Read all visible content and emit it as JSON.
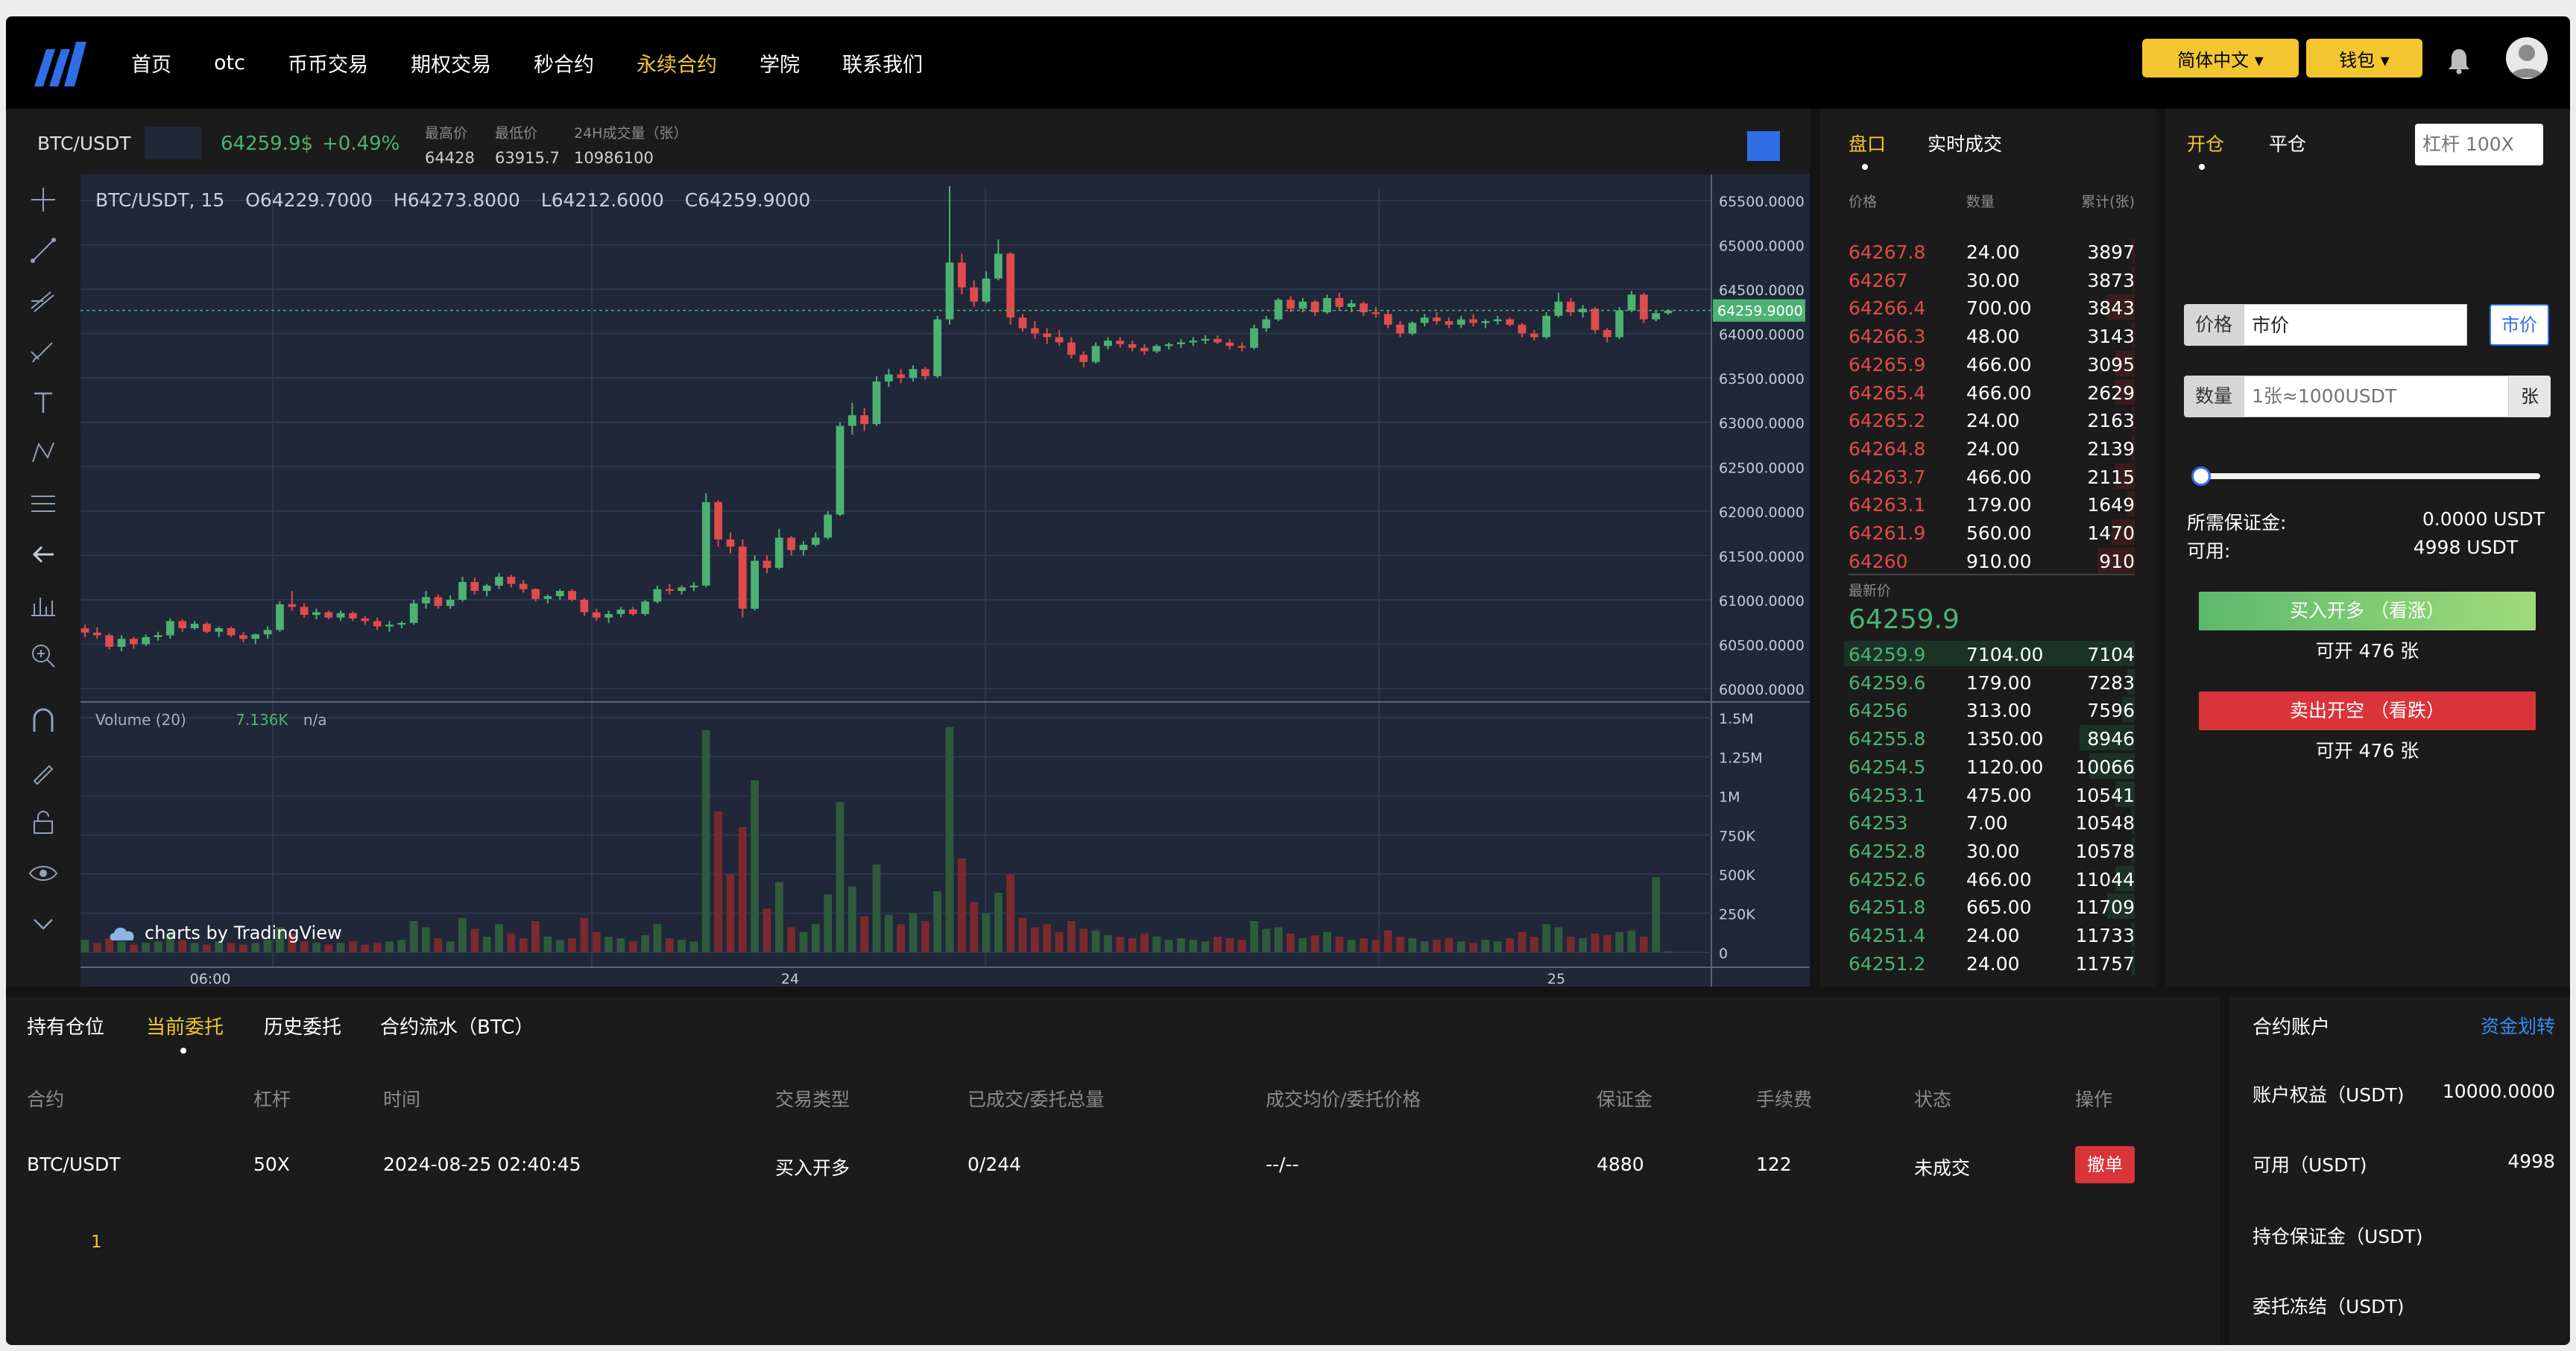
{
  "nav": {
    "items": [
      "首页",
      "otc",
      "币币交易",
      "期权交易",
      "秒合约",
      "永续合约",
      "学院",
      "联系我们"
    ],
    "active_index": 5,
    "lang_label": "简体中文 ▾",
    "wallet_label": "钱包 ▾"
  },
  "ticker": {
    "pair": "BTC/USDT",
    "last_price": "64259.9$",
    "change": "+0.49%",
    "high_label": "最高价",
    "high_value": "64428",
    "low_label": "最低价",
    "low_value": "63915.7",
    "vol_label": "24H成交量（张）",
    "vol_value": "10986100"
  },
  "chart": {
    "symbol": "BTC/USDT, 15",
    "open": "O64229.7000",
    "high": "H64273.8000",
    "low": "L64212.6000",
    "close": "C64259.9000",
    "volume_label": "Volume (20)",
    "volume_value": "7.136K",
    "volume_na": "n/a",
    "brand": "charts by TradingView",
    "current_price_label": "64259.9000",
    "price_ticks": [
      "65500.0000",
      "65000.0000",
      "64500.0000",
      "64000.0000",
      "63500.0000",
      "63000.0000",
      "62500.0000",
      "62000.0000",
      "61500.0000",
      "61000.0000",
      "60500.0000",
      "60000.0000"
    ],
    "volume_ticks": [
      "1.5M",
      "1.25M",
      "1M",
      "750K",
      "500K",
      "250K",
      "0"
    ],
    "time_ticks": [
      "06:00",
      "24",
      "25"
    ]
  },
  "chart_data": {
    "type": "candlestick",
    "title": "BTC/USDT, 15",
    "ylim": [
      60000,
      65500
    ],
    "volume_ylim": [
      0,
      1500000
    ],
    "colors": {
      "up": "#4cb272",
      "down": "#e04b4b",
      "background": "#1f2738"
    },
    "candles": [
      [
        60680,
        60720,
        60580,
        60630
      ],
      [
        60630,
        60690,
        60560,
        60600
      ],
      [
        60600,
        60620,
        60440,
        60470
      ],
      [
        60470,
        60600,
        60420,
        60560
      ],
      [
        60560,
        60580,
        60450,
        60500
      ],
      [
        60500,
        60610,
        60480,
        60580
      ],
      [
        60580,
        60640,
        60540,
        60600
      ],
      [
        60600,
        60790,
        60560,
        60760
      ],
      [
        60760,
        60780,
        60640,
        60680
      ],
      [
        60680,
        60760,
        60660,
        60730
      ],
      [
        60730,
        60750,
        60620,
        60640
      ],
      [
        60640,
        60700,
        60580,
        60680
      ],
      [
        60680,
        60700,
        60580,
        60600
      ],
      [
        60600,
        60640,
        60520,
        60560
      ],
      [
        60560,
        60620,
        60500,
        60610
      ],
      [
        60610,
        60700,
        60560,
        60660
      ],
      [
        60660,
        60980,
        60640,
        60950
      ],
      [
        60950,
        61100,
        60880,
        60920
      ],
      [
        60920,
        60960,
        60800,
        60830
      ],
      [
        60830,
        60900,
        60780,
        60860
      ],
      [
        60860,
        60880,
        60780,
        60800
      ],
      [
        60800,
        60880,
        60760,
        60850
      ],
      [
        60850,
        60870,
        60760,
        60790
      ],
      [
        60790,
        60820,
        60720,
        60760
      ],
      [
        60760,
        60800,
        60660,
        60700
      ],
      [
        60700,
        60760,
        60640,
        60720
      ],
      [
        60720,
        60760,
        60680,
        60740
      ],
      [
        60740,
        61000,
        60720,
        60960
      ],
      [
        60960,
        61100,
        60900,
        61030
      ],
      [
        61030,
        61060,
        60900,
        60930
      ],
      [
        60930,
        61050,
        60900,
        61000
      ],
      [
        61000,
        61260,
        60980,
        61200
      ],
      [
        61200,
        61250,
        61060,
        61100
      ],
      [
        61100,
        61180,
        61040,
        61160
      ],
      [
        61160,
        61300,
        61120,
        61260
      ],
      [
        61260,
        61280,
        61140,
        61180
      ],
      [
        61180,
        61220,
        61080,
        61120
      ],
      [
        61120,
        61130,
        60980,
        61010
      ],
      [
        61010,
        61060,
        60960,
        61040
      ],
      [
        61040,
        61120,
        61000,
        61100
      ],
      [
        61100,
        61120,
        60980,
        61000
      ],
      [
        61000,
        61020,
        60820,
        60860
      ],
      [
        60860,
        60900,
        60760,
        60800
      ],
      [
        60800,
        60880,
        60740,
        60840
      ],
      [
        60840,
        60920,
        60800,
        60890
      ],
      [
        60890,
        60920,
        60820,
        60840
      ],
      [
        60840,
        61000,
        60820,
        60980
      ],
      [
        60980,
        61160,
        60960,
        61120
      ],
      [
        61120,
        61180,
        61060,
        61100
      ],
      [
        61100,
        61160,
        61060,
        61140
      ],
      [
        61140,
        61200,
        61100,
        61160
      ],
      [
        61160,
        62200,
        61140,
        62100
      ],
      [
        62100,
        62120,
        61600,
        61680
      ],
      [
        61680,
        61760,
        61520,
        61600
      ],
      [
        61600,
        61680,
        60800,
        60900
      ],
      [
        60900,
        61500,
        60880,
        61440
      ],
      [
        61440,
        61500,
        61300,
        61360
      ],
      [
        61360,
        61800,
        61340,
        61700
      ],
      [
        61700,
        61720,
        61500,
        61560
      ],
      [
        61560,
        61660,
        61500,
        61620
      ],
      [
        61620,
        61760,
        61600,
        61700
      ],
      [
        61700,
        62000,
        61680,
        61960
      ],
      [
        61960,
        63000,
        61940,
        62960
      ],
      [
        62960,
        63220,
        62860,
        63080
      ],
      [
        63080,
        63160,
        62900,
        62980
      ],
      [
        62980,
        63520,
        62960,
        63460
      ],
      [
        63460,
        63600,
        63400,
        63540
      ],
      [
        63540,
        63600,
        63440,
        63500
      ],
      [
        63500,
        63640,
        63460,
        63600
      ],
      [
        63600,
        63620,
        63480,
        63520
      ],
      [
        63520,
        64200,
        63500,
        64160
      ],
      [
        64160,
        65660,
        64100,
        64800
      ],
      [
        64800,
        64900,
        64440,
        64520
      ],
      [
        64520,
        64600,
        64300,
        64360
      ],
      [
        64360,
        64700,
        64340,
        64620
      ],
      [
        64620,
        65060,
        64600,
        64900
      ],
      [
        64900,
        64920,
        64100,
        64180
      ],
      [
        64180,
        64220,
        64020,
        64060
      ],
      [
        64060,
        64140,
        63940,
        64000
      ],
      [
        64000,
        64060,
        63880,
        63960
      ],
      [
        63960,
        64040,
        63860,
        63900
      ],
      [
        63900,
        63960,
        63720,
        63760
      ],
      [
        63760,
        63800,
        63620,
        63680
      ],
      [
        63680,
        63900,
        63660,
        63860
      ],
      [
        63860,
        63960,
        63820,
        63920
      ],
      [
        63920,
        63960,
        63840,
        63880
      ],
      [
        63880,
        63920,
        63800,
        63840
      ],
      [
        63840,
        63880,
        63760,
        63800
      ],
      [
        63800,
        63880,
        63780,
        63860
      ],
      [
        63860,
        63900,
        63820,
        63880
      ],
      [
        63880,
        63940,
        63840,
        63900
      ],
      [
        63900,
        63960,
        63860,
        63920
      ],
      [
        63920,
        63980,
        63880,
        63940
      ],
      [
        63940,
        63980,
        63880,
        63900
      ],
      [
        63900,
        63940,
        63820,
        63860
      ],
      [
        63860,
        63900,
        63800,
        63840
      ],
      [
        63840,
        64100,
        63820,
        64060
      ],
      [
        64060,
        64200,
        64020,
        64160
      ],
      [
        64160,
        64400,
        64140,
        64380
      ],
      [
        64380,
        64420,
        64240,
        64280
      ],
      [
        64280,
        64400,
        64240,
        64360
      ],
      [
        64360,
        64380,
        64200,
        64240
      ],
      [
        64240,
        64440,
        64220,
        64400
      ],
      [
        64400,
        64460,
        64260,
        64300
      ],
      [
        64300,
        64380,
        64240,
        64340
      ],
      [
        64340,
        64360,
        64200,
        64240
      ],
      [
        64240,
        64300,
        64180,
        64220
      ],
      [
        64220,
        64260,
        64060,
        64100
      ],
      [
        64100,
        64140,
        63960,
        64000
      ],
      [
        64000,
        64140,
        63980,
        64120
      ],
      [
        64120,
        64220,
        64080,
        64180
      ],
      [
        64180,
        64240,
        64100,
        64140
      ],
      [
        64140,
        64180,
        64060,
        64100
      ],
      [
        64100,
        64200,
        64060,
        64160
      ],
      [
        64160,
        64220,
        64080,
        64120
      ],
      [
        64120,
        64160,
        64060,
        64140
      ],
      [
        64140,
        64200,
        64100,
        64160
      ],
      [
        64160,
        64180,
        64080,
        64100
      ],
      [
        64100,
        64120,
        63960,
        64000
      ],
      [
        64000,
        64040,
        63920,
        63960
      ],
      [
        63960,
        64240,
        63940,
        64200
      ],
      [
        64200,
        64460,
        64180,
        64360
      ],
      [
        64360,
        64400,
        64200,
        64240
      ],
      [
        64240,
        64320,
        64180,
        64280
      ],
      [
        64280,
        64300,
        64000,
        64040
      ],
      [
        64040,
        64060,
        63900,
        63960
      ],
      [
        63960,
        64300,
        63940,
        64260
      ],
      [
        64260,
        64480,
        64240,
        64440
      ],
      [
        64440,
        64460,
        64120,
        64160
      ],
      [
        64160,
        64260,
        64140,
        64229.7
      ],
      [
        64229.7,
        64273.8,
        64212.6,
        64259.9
      ]
    ],
    "volumes": [
      80000,
      60000,
      90000,
      70000,
      50000,
      60000,
      70000,
      120000,
      80000,
      60000,
      50000,
      70000,
      60000,
      50000,
      60000,
      80000,
      160000,
      120000,
      70000,
      60000,
      50000,
      60000,
      70000,
      50000,
      60000,
      70000,
      80000,
      200000,
      160000,
      90000,
      70000,
      220000,
      150000,
      100000,
      180000,
      120000,
      90000,
      200000,
      100000,
      80000,
      90000,
      220000,
      130000,
      100000,
      90000,
      70000,
      110000,
      180000,
      90000,
      80000,
      70000,
      1420000,
      900000,
      500000,
      800000,
      1100000,
      280000,
      450000,
      160000,
      130000,
      180000,
      370000,
      960000,
      420000,
      230000,
      560000,
      240000,
      180000,
      250000,
      200000,
      390000,
      1440000,
      600000,
      320000,
      250000,
      380000,
      500000,
      220000,
      160000,
      180000,
      130000,
      200000,
      150000,
      140000,
      110000,
      100000,
      90000,
      120000,
      100000,
      80000,
      90000,
      80000,
      70000,
      100000,
      90000,
      80000,
      200000,
      150000,
      160000,
      120000,
      90000,
      110000,
      130000,
      100000,
      80000,
      90000,
      80000,
      140000,
      100000,
      90000,
      70000,
      80000,
      90000,
      70000,
      60000,
      80000,
      70000,
      90000,
      130000,
      100000,
      180000,
      160000,
      100000,
      90000,
      120000,
      110000,
      130000,
      140000,
      100000,
      480000,
      7136
    ],
    "volume_up": [
      1,
      0,
      0,
      1,
      0,
      1,
      1,
      1,
      0,
      1,
      0,
      1,
      0,
      0,
      1,
      1,
      1,
      0,
      0,
      1,
      0,
      1,
      0,
      0,
      0,
      1,
      1,
      1,
      1,
      0,
      1,
      1,
      0,
      1,
      1,
      0,
      0,
      0,
      1,
      1,
      0,
      0,
      0,
      1,
      1,
      0,
      1,
      1,
      0,
      1,
      1,
      1,
      0,
      0,
      0,
      1,
      0,
      1,
      0,
      1,
      1,
      1,
      1,
      1,
      0,
      1,
      1,
      0,
      1,
      0,
      1,
      1,
      0,
      0,
      1,
      1,
      0,
      0,
      0,
      0,
      0,
      0,
      0,
      1,
      1,
      0,
      0,
      0,
      1,
      1,
      1,
      1,
      1,
      0,
      0,
      0,
      1,
      1,
      1,
      0,
      1,
      0,
      1,
      0,
      1,
      0,
      0,
      0,
      0,
      1,
      1,
      0,
      0,
      1,
      0,
      1,
      1,
      0,
      0,
      0,
      1,
      1,
      0,
      1,
      0,
      0,
      1,
      1,
      0,
      1,
      1
    ],
    "x_ticks": [
      "06:00",
      "24",
      "25"
    ]
  },
  "orderbook": {
    "tab_book": "盘口",
    "tab_trades": "实时成交",
    "col_price": "价格",
    "col_qty": "数量",
    "col_total": "累计(张)",
    "asks": [
      {
        "price": "64267.8",
        "qty": "24.00",
        "total": "3897"
      },
      {
        "price": "64267",
        "qty": "30.00",
        "total": "3873"
      },
      {
        "price": "64266.4",
        "qty": "700.00",
        "total": "3843"
      },
      {
        "price": "64266.3",
        "qty": "48.00",
        "total": "3143"
      },
      {
        "price": "64265.9",
        "qty": "466.00",
        "total": "3095"
      },
      {
        "price": "64265.4",
        "qty": "466.00",
        "total": "2629"
      },
      {
        "price": "64265.2",
        "qty": "24.00",
        "total": "2163"
      },
      {
        "price": "64264.8",
        "qty": "24.00",
        "total": "2139"
      },
      {
        "price": "64263.7",
        "qty": "466.00",
        "total": "2115"
      },
      {
        "price": "64263.1",
        "qty": "179.00",
        "total": "1649"
      },
      {
        "price": "64261.9",
        "qty": "560.00",
        "total": "1470"
      },
      {
        "price": "64260",
        "qty": "910.00",
        "total": "910"
      }
    ],
    "latest_label": "最新价",
    "latest_price": "64259.9",
    "bids": [
      {
        "price": "64259.9",
        "qty": "7104.00",
        "total": "7104"
      },
      {
        "price": "64259.6",
        "qty": "179.00",
        "total": "7283"
      },
      {
        "price": "64256",
        "qty": "313.00",
        "total": "7596"
      },
      {
        "price": "64255.8",
        "qty": "1350.00",
        "total": "8946"
      },
      {
        "price": "64254.5",
        "qty": "1120.00",
        "total": "10066"
      },
      {
        "price": "64253.1",
        "qty": "475.00",
        "total": "10541"
      },
      {
        "price": "64253",
        "qty": "7.00",
        "total": "10548"
      },
      {
        "price": "64252.8",
        "qty": "30.00",
        "total": "10578"
      },
      {
        "price": "64252.6",
        "qty": "466.00",
        "total": "11044"
      },
      {
        "price": "64251.8",
        "qty": "665.00",
        "total": "11709"
      },
      {
        "price": "64251.4",
        "qty": "24.00",
        "total": "11733"
      },
      {
        "price": "64251.2",
        "qty": "24.00",
        "total": "11757"
      }
    ]
  },
  "trade": {
    "tab_open": "开仓",
    "tab_close": "平仓",
    "leverage_placeholder": "杠杆 100X",
    "price_label": "价格",
    "price_value": "市价",
    "market_btn": "市价",
    "qty_label": "数量",
    "qty_placeholder": "1张≈1000USDT",
    "qty_unit": "张",
    "slider_value": 0,
    "margin_label": "所需保证金:",
    "margin_value": "0.0000 USDT",
    "available_label": "可用:",
    "available_value": "4998 USDT",
    "buy_label": "买入开多 （看涨）",
    "buy_open": "可开 476 张",
    "sell_label": "卖出开空 （看跌）",
    "sell_open": "可开 476 张"
  },
  "orders": {
    "tabs": [
      "持有仓位",
      "当前委托",
      "历史委托",
      "合约流水（BTC）"
    ],
    "active_tab": 1,
    "columns": [
      "合约",
      "杠杆",
      "时间",
      "交易类型",
      "已成交/委托总量",
      "成交均价/委托价格",
      "保证金",
      "手续费",
      "状态",
      "操作"
    ],
    "rows": [
      {
        "contract": "BTC/USDT",
        "leverage": "50X",
        "time": "2024-08-25 02:40:45",
        "type": "买入开多",
        "filled": "0/244",
        "avg_price": "--/--",
        "margin": "4880",
        "fee": "122",
        "status": "未成交",
        "action": "撤单"
      }
    ],
    "page": "1"
  },
  "account": {
    "title": "合约账户",
    "transfer": "资金划转",
    "equity_label": "账户权益（USDT)",
    "equity_value": "10000.0000",
    "available_label": "可用（USDT)",
    "available_value": "4998",
    "position_margin_label": "持仓保证金（USDT)",
    "order_frozen_label": "委托冻结（USDT)"
  }
}
